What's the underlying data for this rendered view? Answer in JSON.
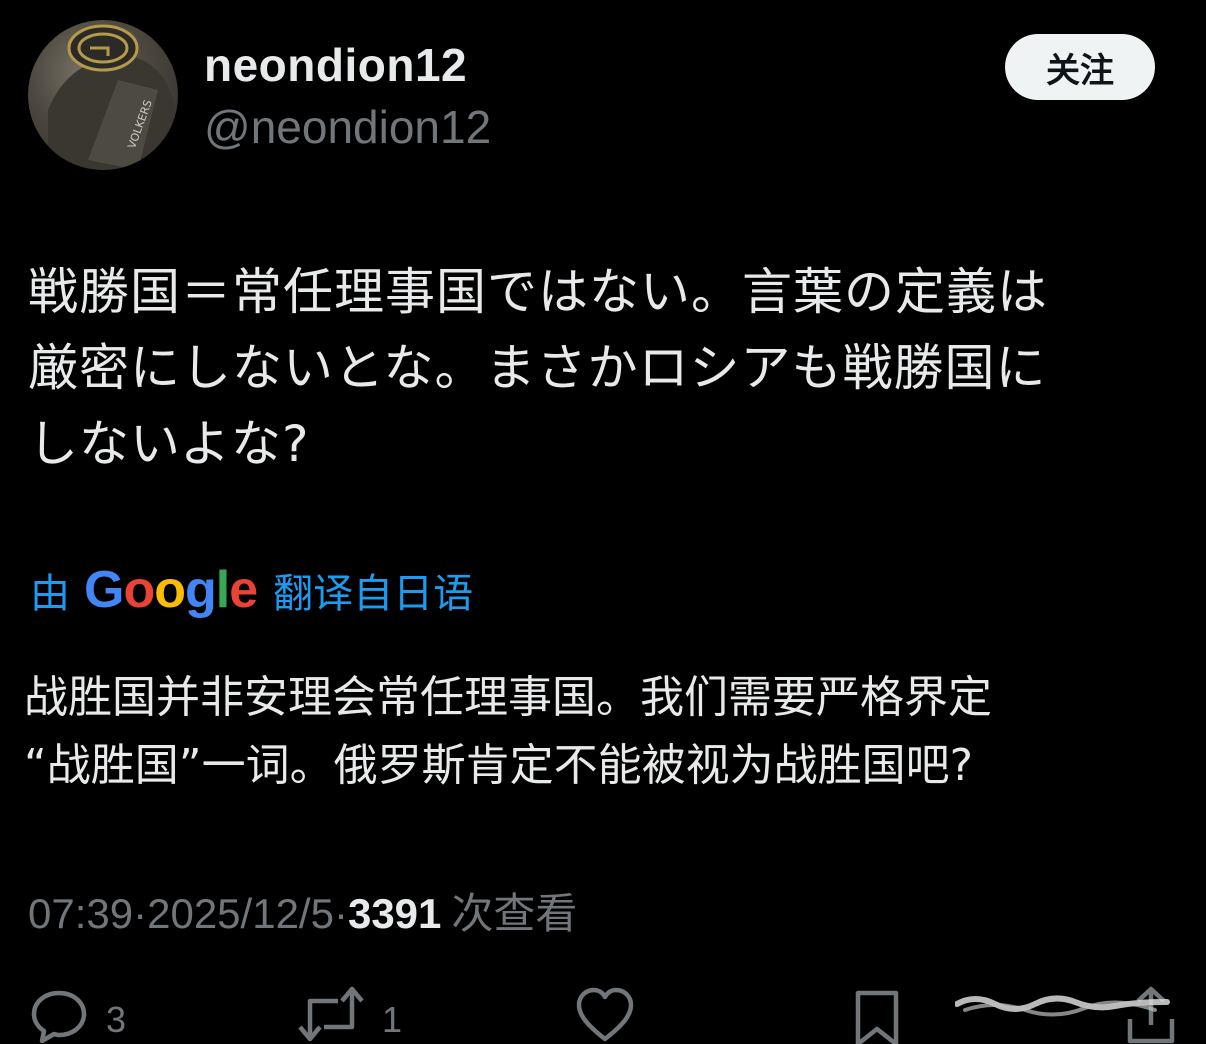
{
  "user": {
    "display_name": "neondion12",
    "handle": "@neondion12",
    "follow_label": "关注"
  },
  "tweet": {
    "original_lines": [
      "戦勝国＝常任理事国ではない。言葉の定義は",
      "厳密にしないとな。まさかロシアも戦勝国に",
      "しないよな?"
    ],
    "translation_prefix": "由",
    "translation_brand": "Google",
    "translation_suffix": "翻译自日语",
    "translated_lines": [
      "战胜国并非安理会常任理事国。我们需要严格界定",
      "“战胜国”一词。俄罗斯肯定不能被视为战胜国吧?"
    ]
  },
  "meta": {
    "time": "07:39",
    "date": "2025/12/5",
    "separator": " · ",
    "views_count": "3391",
    "views_label": "次查看"
  },
  "actions": {
    "reply_count": "3",
    "retweet_count": "1"
  },
  "colors": {
    "background": "#000000",
    "text": "#e7e9ea",
    "muted": "#71767b",
    "link": "#1d9bf0",
    "google_blue": "#4285f4",
    "google_red": "#ea4335",
    "google_yellow": "#fbbc05",
    "google_green": "#34a853"
  },
  "icons": [
    "reply-icon",
    "retweet-icon",
    "like-icon",
    "bookmark-icon",
    "share-icon"
  ]
}
